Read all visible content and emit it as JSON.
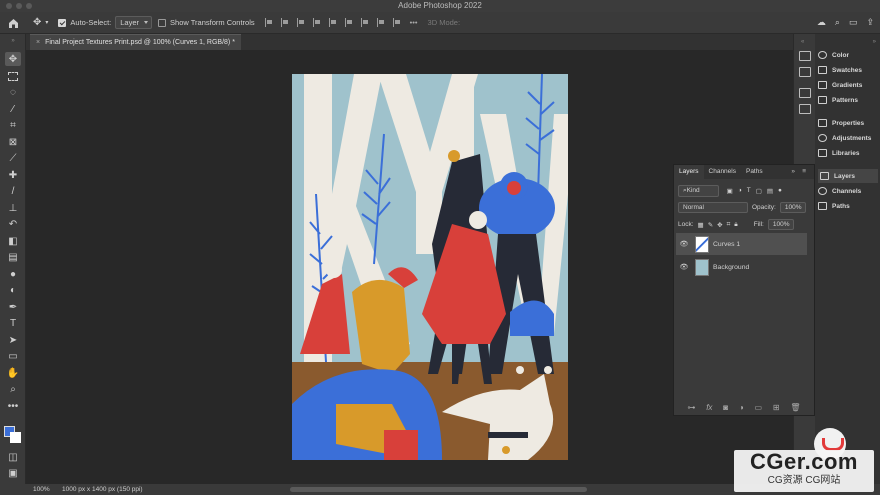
{
  "app": {
    "window_title": "Adobe Photoshop 2022"
  },
  "options_bar": {
    "auto_select_label": "Auto-Select:",
    "auto_select_target": "Layer",
    "show_transform_label": "Show Transform Controls",
    "mode_3d_label": "3D Mode:"
  },
  "document_tab": {
    "title": "Final Project Textures Print.psd @ 100% (Curves 1, RGB/8) *",
    "close": "×"
  },
  "artwork": {
    "colors": {
      "sky": "#9fc2cc",
      "floor": "#8a5a2e",
      "blue": "#3b6fd8",
      "red": "#d8403a",
      "dark": "#262a36",
      "ochre": "#d89a2a",
      "white": "#eeeae2"
    }
  },
  "right_panel": {
    "items": [
      {
        "label": "Color",
        "icon": "color-wheel-icon"
      },
      {
        "label": "Swatches",
        "icon": "swatches-grid-icon"
      },
      {
        "label": "Gradients",
        "icon": "gradient-icon"
      },
      {
        "label": "Patterns",
        "icon": "patterns-icon"
      },
      {
        "label": "Properties",
        "icon": "properties-sliders-icon"
      },
      {
        "label": "Adjustments",
        "icon": "adjustments-icon"
      },
      {
        "label": "Libraries",
        "icon": "libraries-icon"
      },
      {
        "label": "Layers",
        "icon": "layers-icon"
      },
      {
        "label": "Channels",
        "icon": "channels-icon"
      },
      {
        "label": "Paths",
        "icon": "paths-icon"
      }
    ]
  },
  "layers_panel": {
    "tabs": [
      "Layers",
      "Channels",
      "Paths"
    ],
    "filter_kind": "Kind",
    "blend_mode": "Normal",
    "opacity_label": "Opacity:",
    "opacity_value": "100%",
    "lock_label": "Lock:",
    "fill_label": "Fill:",
    "fill_value": "100%",
    "layers": [
      {
        "name": "Curves 1",
        "selected": true
      },
      {
        "name": "Background",
        "selected": false
      }
    ],
    "footer_icons": [
      "link-icon",
      "fx-icon",
      "mask-icon",
      "adjustment-icon",
      "folder-icon",
      "new-layer-icon",
      "trash-icon"
    ]
  },
  "status_bar": {
    "zoom": "100%",
    "doc_info": "1000 px x 1400 px (150 ppi)"
  },
  "watermark": {
    "main": "CGer.com",
    "sub": "CG资源 CG网站"
  }
}
